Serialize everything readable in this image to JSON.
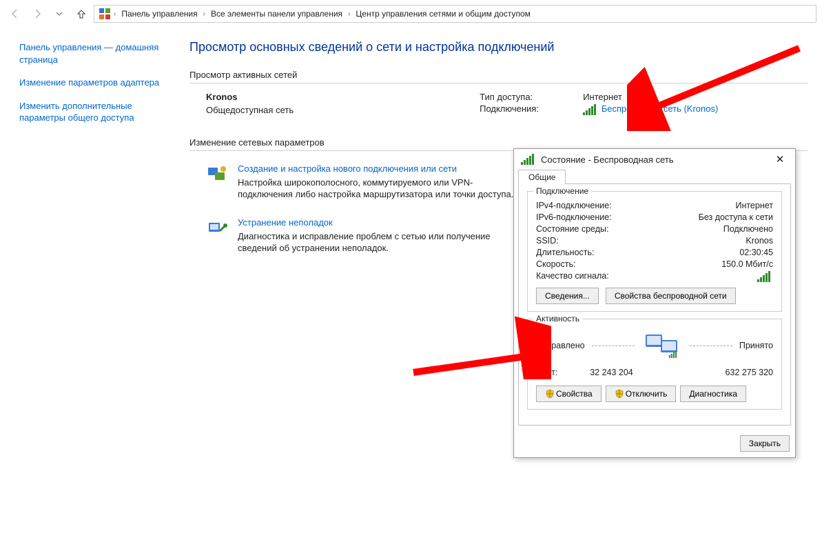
{
  "breadcrumb": {
    "seg1": "Панель управления",
    "seg2": "Все элементы панели управления",
    "seg3": "Центр управления сетями и общим доступом"
  },
  "sidebar": {
    "home": "Панель управления — домашняя страница",
    "adapter": "Изменение параметров адаптера",
    "sharing": "Изменить дополнительные параметры общего доступа"
  },
  "title": "Просмотр основных сведений о сети и настройка подключений",
  "active_header": "Просмотр активных сетей",
  "network": {
    "name": "Kronos",
    "kind": "Общедоступная сеть",
    "access_k": "Тип доступа:",
    "access_v": "Интернет",
    "conn_k": "Подключения:",
    "conn_v": "Беспроводная сеть (Kronos)"
  },
  "change_header": "Изменение сетевых параметров",
  "task1": {
    "link": "Создание и настройка нового подключения или сети",
    "desc": "Настройка широкополосного, коммутируемого или VPN-подключения либо настройка маршрутизатора или точки доступа."
  },
  "task2": {
    "link": "Устранение неполадок",
    "desc": "Диагностика и исправление проблем с сетью или получение сведений об устранении неполадок."
  },
  "dlg": {
    "title": "Состояние - Беспроводная сеть",
    "tab": "Общие",
    "grp_conn": "Подключение",
    "ipv4_k": "IPv4-подключение:",
    "ipv4_v": "Интернет",
    "ipv6_k": "IPv6-подключение:",
    "ipv6_v": "Без доступа к сети",
    "media_k": "Состояние среды:",
    "media_v": "Подключено",
    "ssid_k": "SSID:",
    "ssid_v": "Kronos",
    "dur_k": "Длительность:",
    "dur_v": "02:30:45",
    "speed_k": "Скорость:",
    "speed_v": "150.0 Мбит/с",
    "sig_k": "Качество сигнала:",
    "btn_details": "Сведения...",
    "btn_wprops": "Свойства беспроводной сети",
    "grp_act": "Активность",
    "sent": "Отправлено",
    "recv": "Принято",
    "bytes_k": "Байт:",
    "bytes_sent": "32 243 204",
    "bytes_recv": "632 275 320",
    "btn_props": "Свойства",
    "btn_disc": "Отключить",
    "btn_diag": "Диагностика",
    "btn_close": "Закрыть"
  }
}
